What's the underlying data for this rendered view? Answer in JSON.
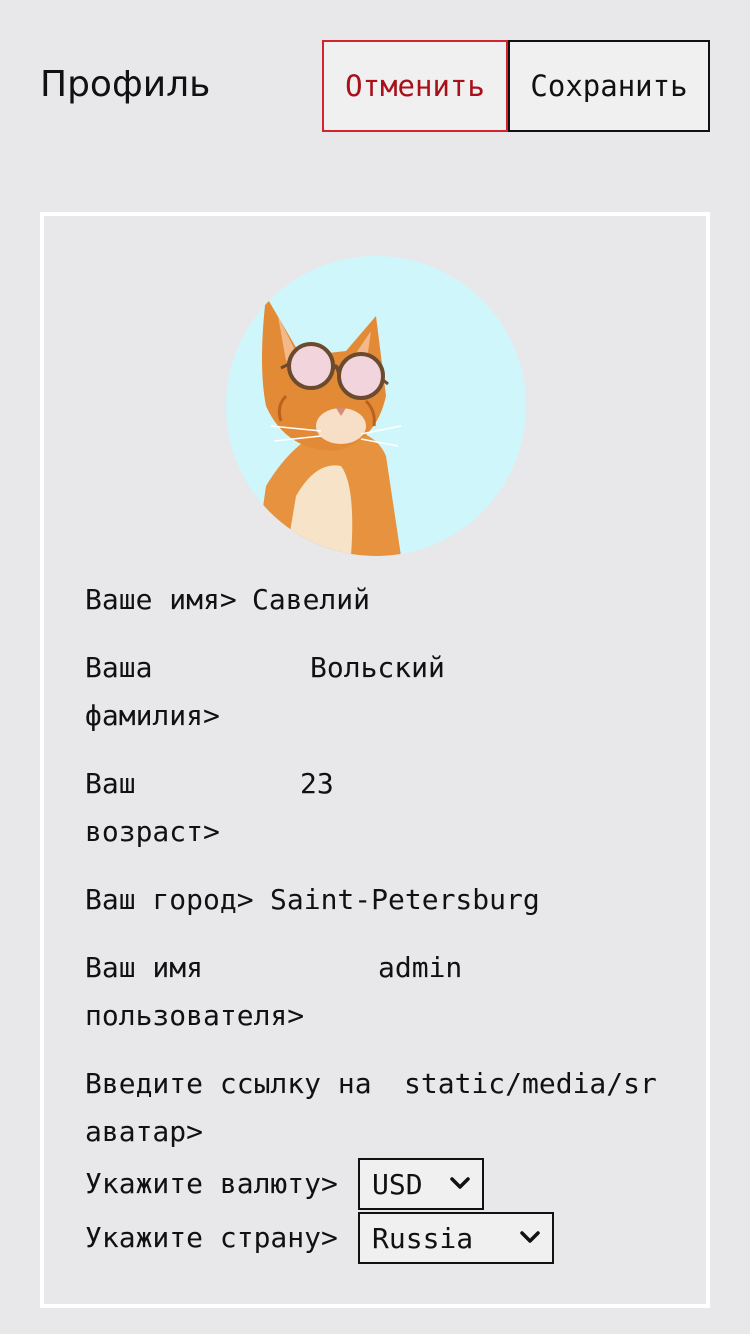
{
  "header": {
    "title": "Профиль",
    "cancel_label": "Отменить",
    "save_label": "Сохранить"
  },
  "profile": {
    "name_label": "Ваше имя>",
    "name_value": "Савелий",
    "surname_label_line1": "Ваша",
    "surname_label_line2": "фамилия>",
    "surname_value": "Вольский",
    "age_label_line1": "Ваш",
    "age_label_line2": "возраст>",
    "age_value": "23",
    "city_label": "Ваш город>",
    "city_value": "Saint-Petersburg",
    "username_label_line1": "Ваш имя",
    "username_label_line2": "пользователя>",
    "username_value": "admin",
    "avatar_label_line1": "Введите ссылку на",
    "avatar_label_line2": "аватар>",
    "avatar_value": "static/media/sr",
    "currency_label": "Укажите валюту>",
    "currency_value": "USD",
    "country_label": "Укажите страну>",
    "country_value": "Russia"
  },
  "colors": {
    "background": "#e8e7ea",
    "cancel_border": "#d1242f",
    "cancel_text": "#a8101a",
    "avatar_background": "#cff6fb"
  },
  "icons": {
    "avatar": "cat-with-sunglasses-photo",
    "select_arrow": "chevron-down-icon"
  }
}
